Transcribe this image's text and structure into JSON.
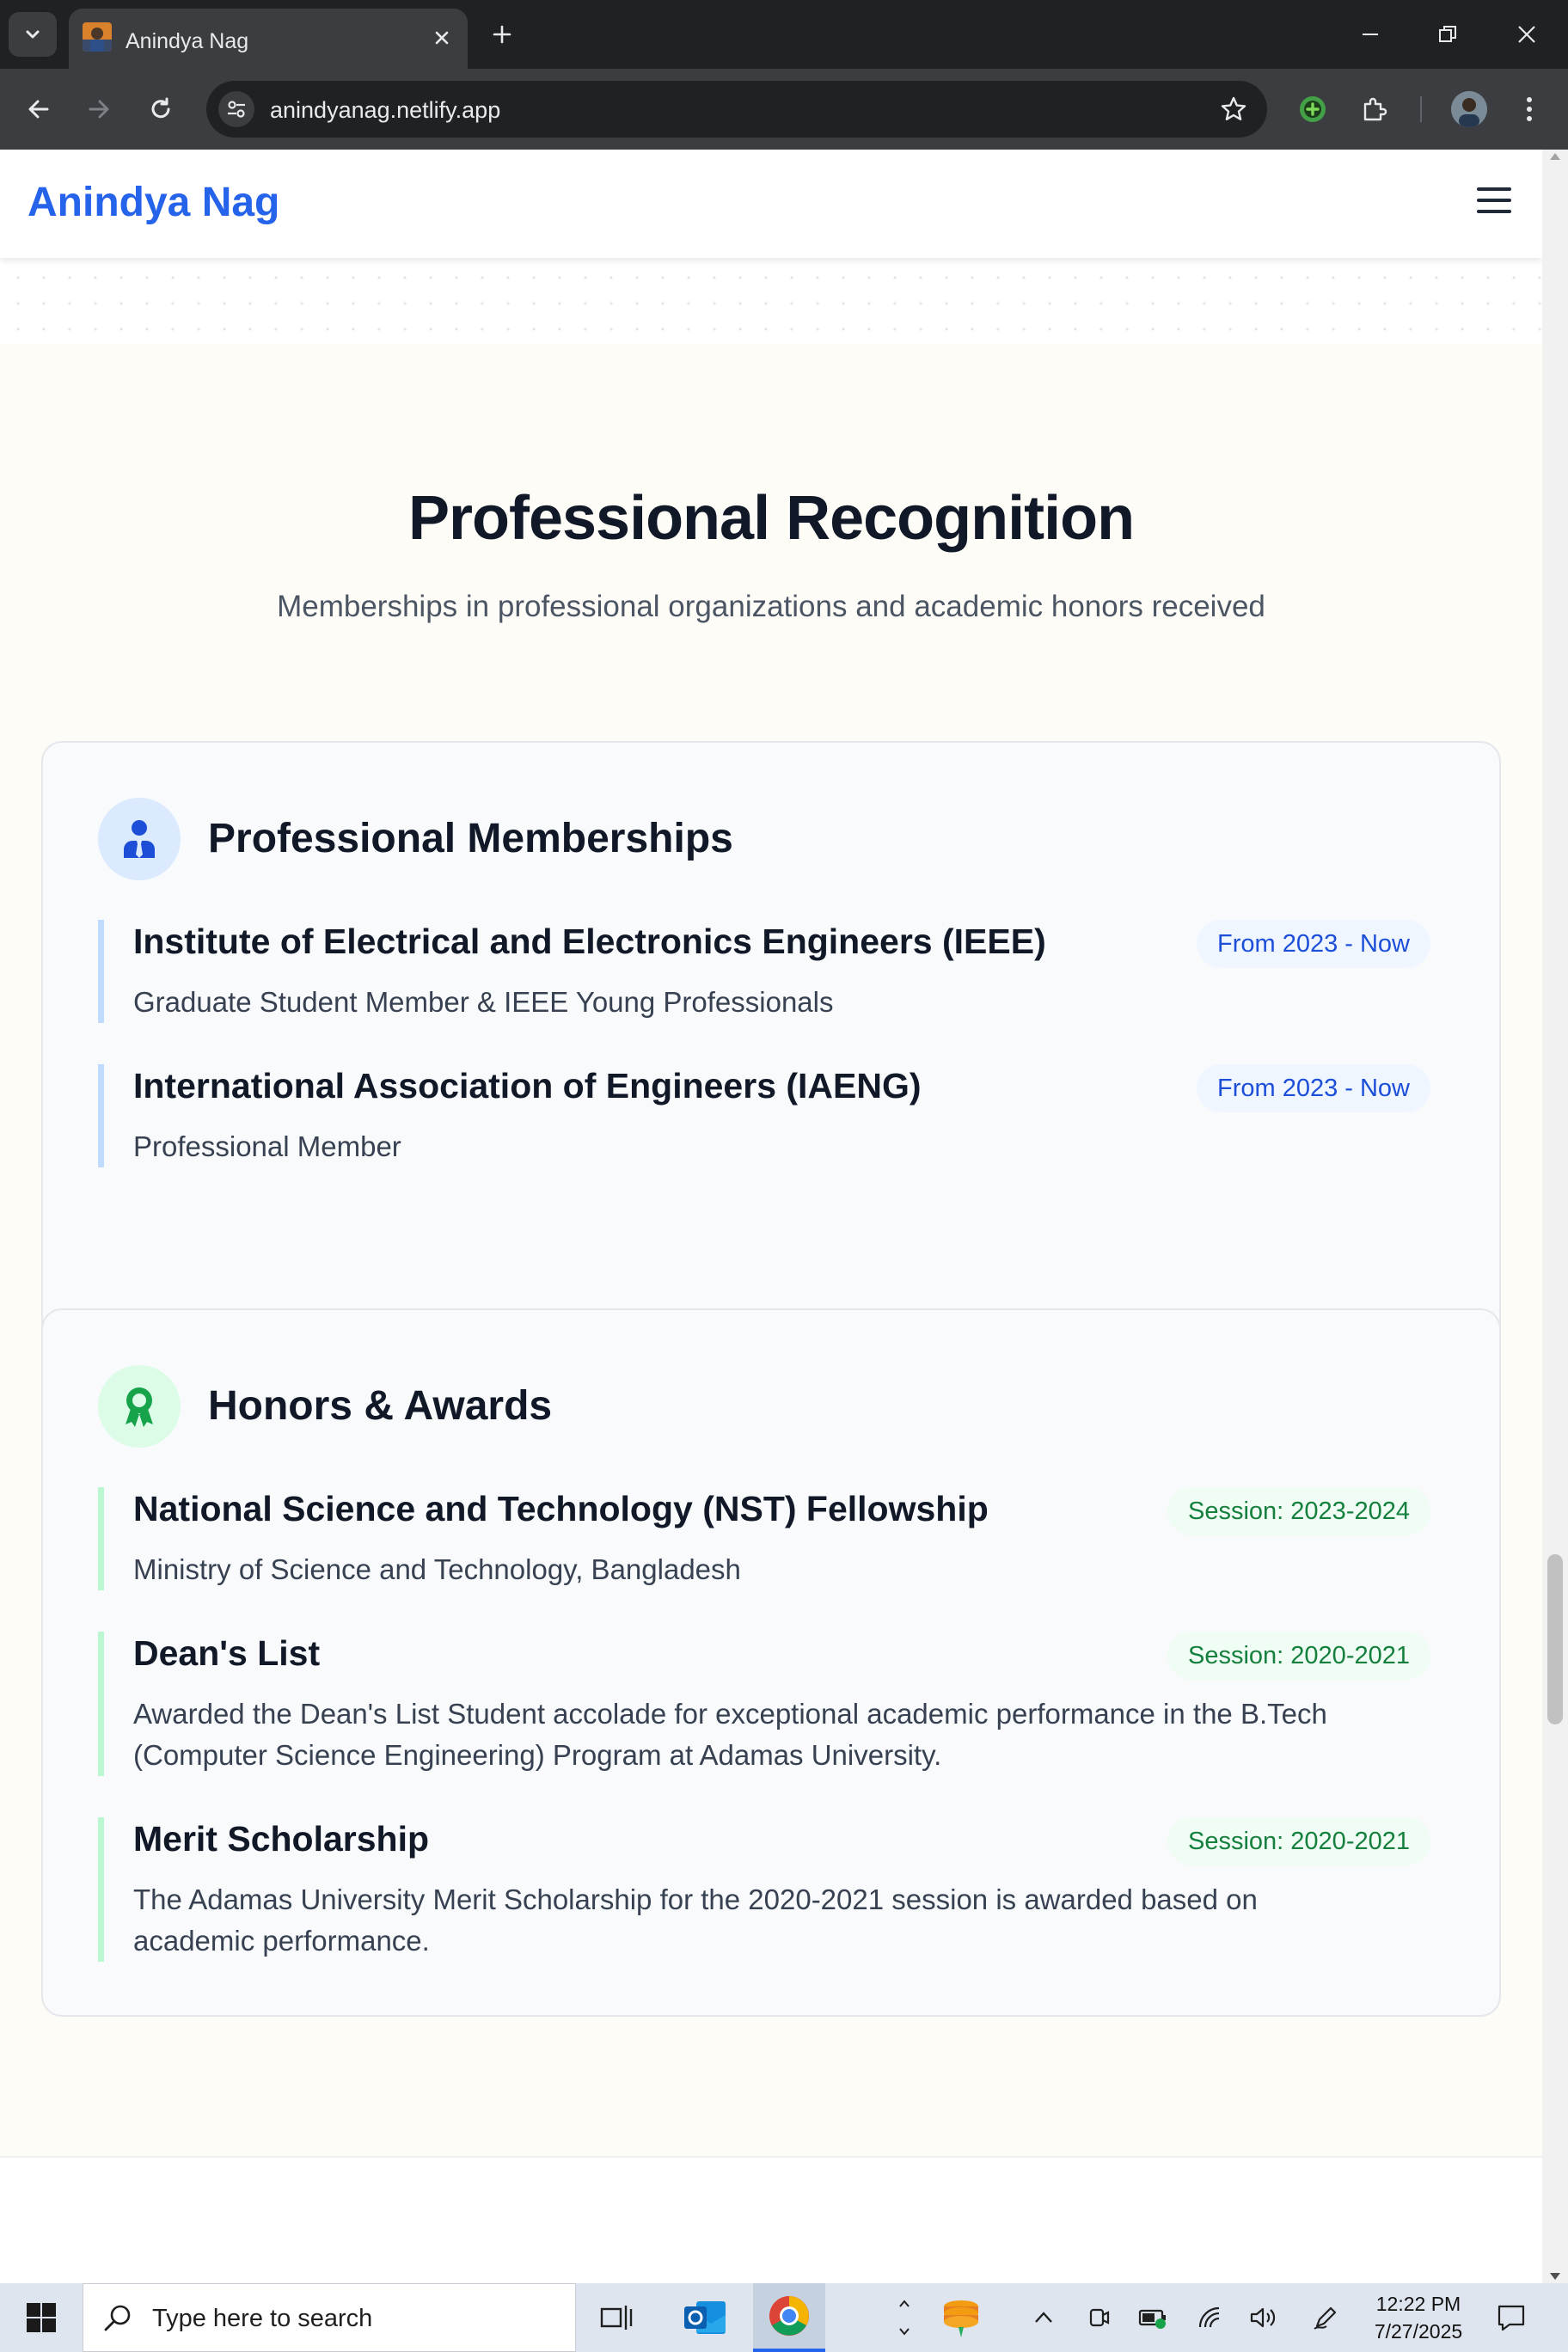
{
  "browser": {
    "tab_title": "Anindya Nag",
    "url": "anindyanag.netlify.app"
  },
  "site": {
    "brand": "Anindya Nag",
    "accent_color": "#2563eb"
  },
  "section": {
    "title": "Professional Recognition",
    "subtitle": "Memberships in professional organizations and academic honors received"
  },
  "memberships": {
    "heading": "Professional Memberships",
    "icon": "user-tie-icon",
    "items": [
      {
        "title": "Institute of Electrical and Electronics Engineers (IEEE)",
        "period": "From 2023 - Now",
        "description": "Graduate Student Member & IEEE Young Professionals"
      },
      {
        "title": "International Association of Engineers (IAENG)",
        "period": "From 2023 - Now",
        "description": "Professional Member"
      }
    ]
  },
  "honors": {
    "heading": "Honors & Awards",
    "icon": "award-ribbon-icon",
    "items": [
      {
        "title": "National Science and Technology (NST) Fellowship",
        "period": "Session: 2023-2024",
        "description": "Ministry of Science and Technology, Bangladesh"
      },
      {
        "title": "Dean's List",
        "period": "Session: 2020-2021",
        "description": "Awarded the Dean's List Student accolade for exceptional academic performance in the B.Tech (Computer Science Engineering) Program at Adamas University."
      },
      {
        "title": "Merit Scholarship",
        "period": "Session: 2020-2021",
        "description": "The Adamas University Merit Scholarship for the 2020-2021 session is awarded based on academic performance."
      }
    ]
  },
  "taskbar": {
    "search_placeholder": "Type here to search",
    "time": "12:22 PM",
    "date": "7/27/2025"
  }
}
